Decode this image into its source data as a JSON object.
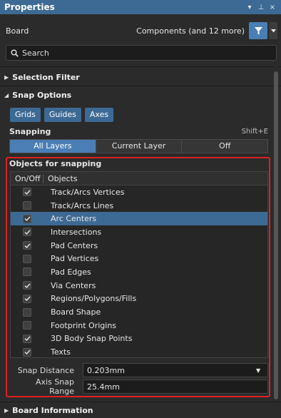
{
  "panel": {
    "title": "Properties",
    "controls": [
      "▾",
      "⊥",
      "×"
    ]
  },
  "board_row": {
    "label": "Board",
    "components": "Components (and 12 more)"
  },
  "search": {
    "placeholder": "Search"
  },
  "sections": {
    "selection_filter": "Selection Filter",
    "snap_options": "Snap Options",
    "board_information": "Board Information"
  },
  "snap_buttons": [
    "Grids",
    "Guides",
    "Axes"
  ],
  "snapping": {
    "label": "Snapping",
    "shortcut": "Shift+E",
    "options": [
      "All Layers",
      "Current Layer",
      "Off"
    ],
    "active": "All Layers"
  },
  "objects_for_snapping": {
    "title": "Objects for snapping",
    "headers": [
      "On/Off",
      "Objects"
    ],
    "rows": [
      {
        "label": "Track/Arcs Vertices",
        "on": true,
        "selected": false
      },
      {
        "label": "Track/Arcs Lines",
        "on": false,
        "selected": false
      },
      {
        "label": "Arc Centers",
        "on": true,
        "selected": true
      },
      {
        "label": "Intersections",
        "on": true,
        "selected": false
      },
      {
        "label": "Pad Centers",
        "on": true,
        "selected": false
      },
      {
        "label": "Pad Vertices",
        "on": false,
        "selected": false
      },
      {
        "label": "Pad Edges",
        "on": false,
        "selected": false
      },
      {
        "label": "Via Centers",
        "on": true,
        "selected": false
      },
      {
        "label": "Regions/Polygons/Fills",
        "on": true,
        "selected": false
      },
      {
        "label": "Board Shape",
        "on": false,
        "selected": false
      },
      {
        "label": "Footprint Origins",
        "on": false,
        "selected": false
      },
      {
        "label": "3D Body Snap Points",
        "on": true,
        "selected": false
      },
      {
        "label": "Texts",
        "on": true,
        "selected": false
      }
    ]
  },
  "snap_distance": {
    "label": "Snap Distance",
    "value": "0.203mm"
  },
  "axis_snap_range": {
    "label": "Axis Snap Range",
    "value": "25.4mm"
  },
  "colors": {
    "accent": "#3d6a94",
    "highlight_border": "#e02020",
    "background": "#2b2b2b"
  }
}
